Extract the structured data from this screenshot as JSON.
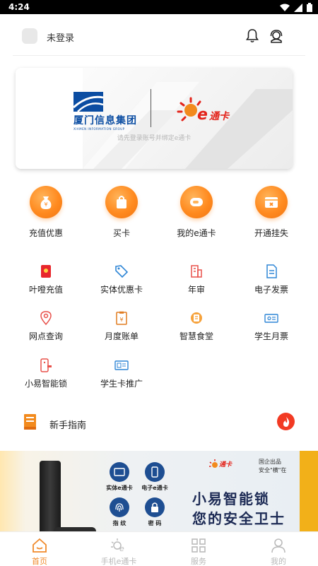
{
  "status_bar": {
    "time": "4:24"
  },
  "header": {
    "login_status": "未登录"
  },
  "card": {
    "brand1_cn": "厦门信息集团",
    "brand1_en": "XIAMEN INFORMATION GROUP",
    "brand2": "通卡",
    "hint": "请先登录账号并绑定e通卡"
  },
  "main_actions": [
    {
      "label": "充值优惠",
      "icon": "money-bag-icon"
    },
    {
      "label": "买卡",
      "icon": "shopping-bag-icon"
    },
    {
      "label": "我的e通卡",
      "icon": "card-icon"
    },
    {
      "label": "开通挂失",
      "icon": "wallet-icon"
    }
  ],
  "services": [
    {
      "label": "叶噔充值",
      "icon": "red-packet-icon"
    },
    {
      "label": "实体优惠卡",
      "icon": "tag-icon"
    },
    {
      "label": "年审",
      "icon": "building-icon"
    },
    {
      "label": "电子发票",
      "icon": "invoice-icon"
    },
    {
      "label": "网点查询",
      "icon": "location-icon"
    },
    {
      "label": "月度账单",
      "icon": "bill-icon"
    },
    {
      "label": "智慧食堂",
      "icon": "canteen-icon"
    },
    {
      "label": "学生月票",
      "icon": "ticket-icon"
    },
    {
      "label": "小易智能锁",
      "icon": "smart-lock-icon"
    },
    {
      "label": "学生卡推广",
      "icon": "student-card-icon"
    }
  ],
  "guide": {
    "label": "新手指南"
  },
  "banner": {
    "brand": "通卡",
    "tag1": "国企出品",
    "tag2": "安全\"横\"在",
    "title1": "小易智能锁",
    "title2": "您的安全卫士",
    "features": [
      "实体e通卡",
      "电子e通卡",
      "指  纹",
      "密  码"
    ]
  },
  "tabs": [
    {
      "label": "首页",
      "active": true
    },
    {
      "label": "手机e通卡",
      "active": false
    },
    {
      "label": "服务",
      "active": false
    },
    {
      "label": "我的",
      "active": false
    }
  ],
  "colors": {
    "accent": "#f08a2b",
    "orange": "#ff8a1f",
    "brand_blue": "#0b4da2",
    "brand_red": "#e3231a"
  }
}
